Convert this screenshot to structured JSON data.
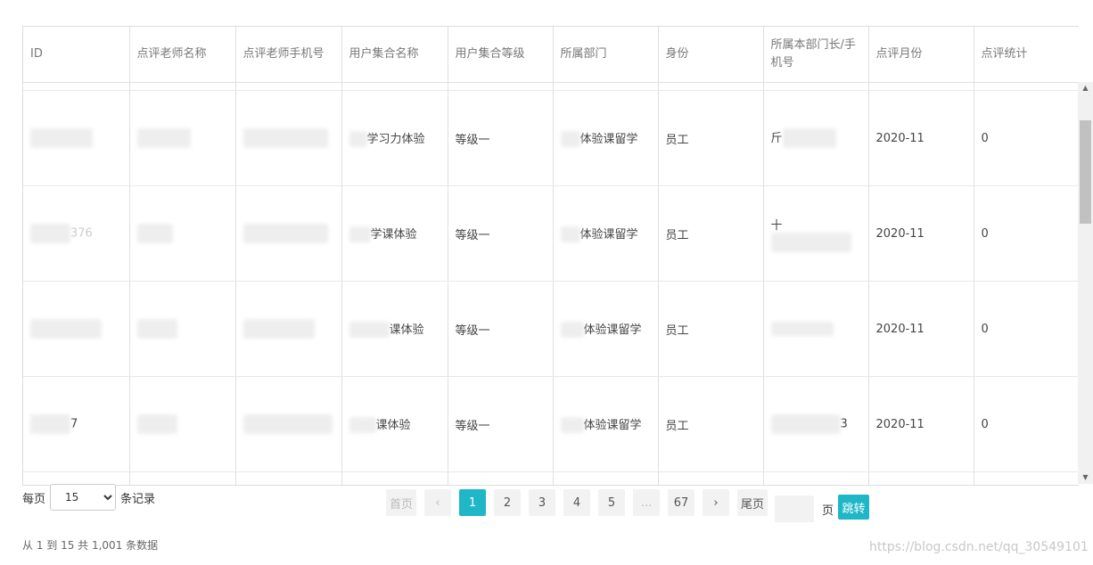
{
  "table": {
    "columns": [
      "ID",
      "点评老师名称",
      "点评老师手机号",
      "用户集合名称",
      "用户集合等级",
      "所属部门",
      "身份",
      "所属本部门长/手机号",
      "点评月份",
      "点评统计"
    ],
    "rows": [
      {
        "id": "",
        "teacher": "",
        "phone": "",
        "group": "学习力体验",
        "level": "等级一",
        "dept": "体验课留学",
        "role": "员工",
        "leader": "斤",
        "month": "2020-11",
        "count": "0"
      },
      {
        "id": "376",
        "teacher": "",
        "phone": "",
        "group": "学课体验",
        "level": "等级一",
        "dept": "体验课留学",
        "role": "员工",
        "leader": "十",
        "month": "2020-11",
        "count": "0"
      },
      {
        "id": "",
        "teacher": "",
        "phone": "",
        "group": "课体验",
        "level": "等级一",
        "dept": "体验课留学",
        "role": "员工",
        "leader": "",
        "month": "2020-11",
        "count": "0"
      },
      {
        "id": "7",
        "teacher": "",
        "phone": "",
        "group": "课体验",
        "level": "等级一",
        "dept": "体验课留学",
        "role": "员工",
        "leader": "3",
        "month": "2020-11",
        "count": "0"
      }
    ]
  },
  "page_size": {
    "prefix": "每页",
    "value": "15",
    "suffix": "条记录"
  },
  "pager": {
    "first": "首页",
    "prev": "‹",
    "pages": [
      "1",
      "2",
      "3",
      "4",
      "5",
      "...",
      "67"
    ],
    "next": "›",
    "last": "尾页",
    "jump_unit": "页",
    "jump_button": "跳转"
  },
  "summary": "从 1 到 15 共 1,001 条数据",
  "watermark": "https://blog.csdn.net/qq_30549101",
  "colors": {
    "accent": "#1fb7c7",
    "link": "#4a7bb0"
  }
}
